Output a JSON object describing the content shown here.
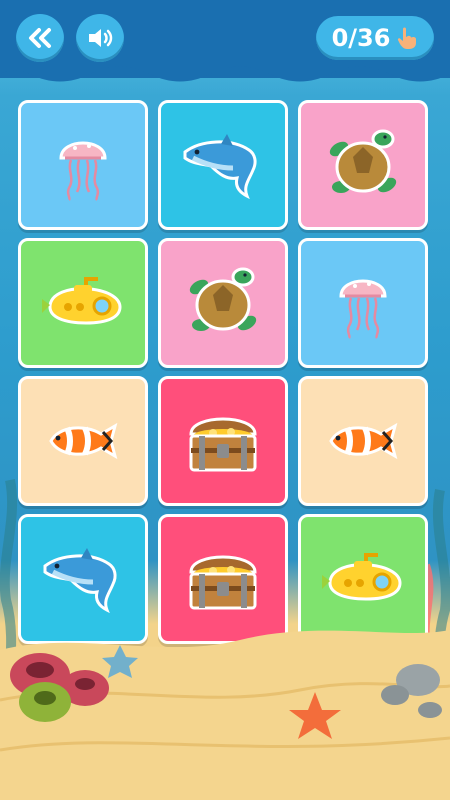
{
  "header": {
    "back_icon": "double-chevron-left-icon",
    "sound_icon": "speaker-icon",
    "progress_text": "0/36",
    "pointer_icon": "hand-pointer-icon"
  },
  "colors": {
    "header_bg": "#1a6fb0",
    "button_bg": "#3fb6e8",
    "card_blue": "#6bc8f6",
    "card_cyan": "#2ec3e6",
    "card_pink": "#f9a3c9",
    "card_green": "#7fe36e",
    "card_peach": "#fde0b5",
    "card_red": "#ff4f7b"
  },
  "board": {
    "cards": [
      {
        "item": "jellyfish",
        "bg": "#6bc8f6"
      },
      {
        "item": "dolphin",
        "bg": "#2ec3e6"
      },
      {
        "item": "turtle",
        "bg": "#f9a3c9"
      },
      {
        "item": "submarine",
        "bg": "#7fe36e"
      },
      {
        "item": "turtle",
        "bg": "#f9a3c9"
      },
      {
        "item": "jellyfish",
        "bg": "#6bc8f6"
      },
      {
        "item": "clownfish",
        "bg": "#fde0b5"
      },
      {
        "item": "treasure-chest",
        "bg": "#ff4f7b"
      },
      {
        "item": "clownfish",
        "bg": "#fde0b5"
      },
      {
        "item": "dolphin",
        "bg": "#2ec3e6"
      },
      {
        "item": "treasure-chest",
        "bg": "#ff4f7b"
      },
      {
        "item": "submarine",
        "bg": "#7fe36e"
      }
    ]
  }
}
